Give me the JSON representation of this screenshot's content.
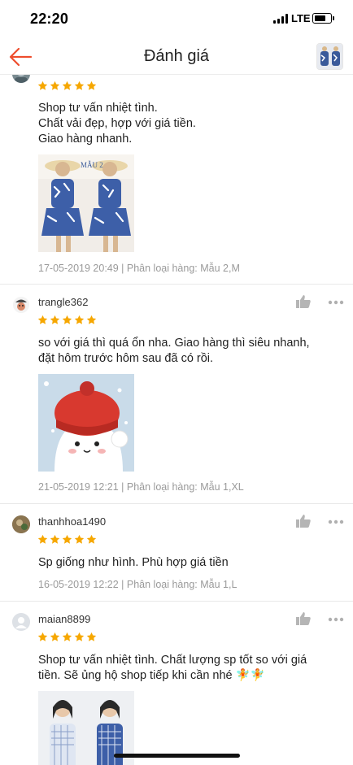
{
  "status_bar": {
    "time": "22:20",
    "network": "LTE"
  },
  "header": {
    "title": "Đánh giá",
    "back_icon": "back-arrow-icon",
    "accent": "#ee4d2d"
  },
  "reviews": [
    {
      "username": "",
      "stars": 5,
      "text": "Shop tư vấn nhiệt tình.\nChất vải đẹp, hợp với giá tiền.\nGiao hàng nhanh.",
      "photo_label": "MẪU 2",
      "meta": "17-05-2019 20:49 | Phân loại hàng: Mẫu 2,M"
    },
    {
      "username": "trangle362",
      "stars": 5,
      "text": "so với giá thì quá ổn nha. Giao hàng thì siêu nhanh, đặt hôm trước hôm sau đã có rồi.",
      "meta": "21-05-2019 12:21 | Phân loại hàng: Mẫu 1,XL"
    },
    {
      "username": "thanhhoa1490",
      "stars": 5,
      "text": "Sp giống như hình. Phù hợp giá tiền",
      "meta": "16-05-2019 12:22 | Phân loại hàng: Mẫu 1,L"
    },
    {
      "username": "maian8899",
      "stars": 5,
      "text": "Shop tư vấn nhiệt tình. Chất lượng sp tốt so với giá tiền. Sẽ ủng hộ shop tiếp khi cần nhé 🧚🧚",
      "meta": ""
    }
  ],
  "colors": {
    "star": "#f6a700",
    "meta": "#9a9a9a",
    "divider": "#e9e9e9"
  }
}
